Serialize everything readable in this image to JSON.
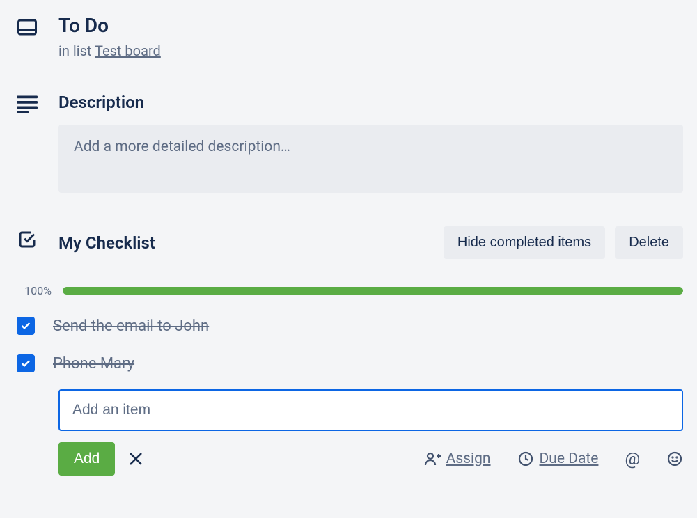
{
  "header": {
    "title": "To Do",
    "in_list_prefix": "in list ",
    "list_name": "Test board"
  },
  "description": {
    "heading": "Description",
    "placeholder": "Add a more detailed description…"
  },
  "checklist": {
    "heading": "My Checklist",
    "hide_label": "Hide completed items",
    "delete_label": "Delete",
    "progress_percent": "100%",
    "progress_value": 100,
    "items": [
      {
        "label": "Send the email to John",
        "checked": true
      },
      {
        "label": "Phone Mary",
        "checked": true
      }
    ],
    "add_item_placeholder": "Add an item",
    "add_button": "Add",
    "assign_label": "Assign",
    "due_date_label": "Due Date"
  }
}
